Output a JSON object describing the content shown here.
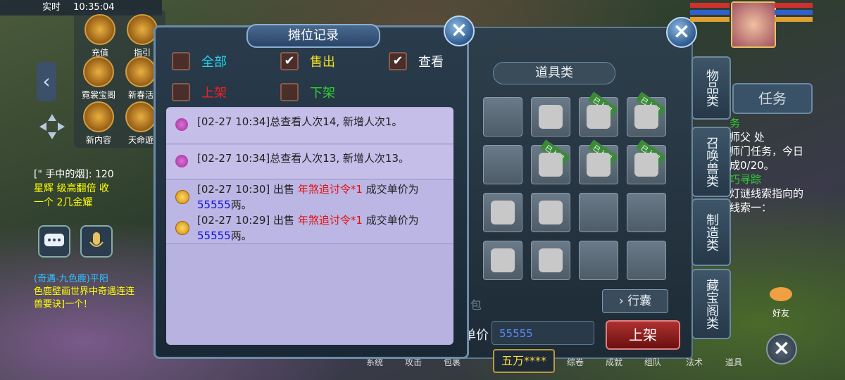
{
  "status": {
    "time_label": "实时",
    "time": "10:35:04"
  },
  "left_menu": [
    {
      "label": "充值",
      "icon": "treasure-chest-icon"
    },
    {
      "label": "指引",
      "icon": "guide-icon"
    },
    {
      "label": "霓裳宝阁",
      "icon": "costume-shop-icon"
    },
    {
      "label": "新春活",
      "icon": "spring-event-icon"
    },
    {
      "label": "新内容",
      "icon": "new-content-icon"
    },
    {
      "label": "天命遊",
      "icon": "fate-icon"
    }
  ],
  "chat": {
    "line1": "[\" 手中的烟]: 120",
    "line2": "星辉 级高翻倍 收",
    "line3": "一个 2几金耀",
    "world1": "(奇遇-九色鹿)平阳",
    "world2": "色鹿壁画世界中奇遇连连",
    "world3": "兽要诀]一个！"
  },
  "dialog": {
    "title": "摊位记录",
    "filters": [
      {
        "label": "全部",
        "checked": false,
        "color": "#22d8f0"
      },
      {
        "label": "售出",
        "checked": true,
        "color": "#f0e020"
      },
      {
        "label": "查看",
        "checked": true,
        "color": "#ffffff"
      },
      {
        "label": "上架",
        "checked": false,
        "color": "#f02020"
      },
      {
        "label": "下架",
        "checked": false,
        "color": "#30d030"
      }
    ],
    "records": [
      {
        "icon": "person-icon",
        "text": "[02-27 10:34]总查看人次14, 新增人次1。"
      },
      {
        "icon": "person-icon",
        "text": "[02-27 10:34]总查看人次13, 新增人次13。"
      },
      {
        "icon": "coin-icon",
        "prefix": "[02-27 10:30] 出售 ",
        "item": "年煞追讨令",
        "qty": "*1",
        "mid": " 成交单价为",
        "price": "55555",
        "suffix": "两。"
      },
      {
        "icon": "coin-icon",
        "prefix": "[02-27 10:29] 出售 ",
        "item": "年煞追讨令",
        "qty": "*1",
        "mid": " 成交单价为",
        "price": "55555",
        "suffix": "两。"
      }
    ]
  },
  "bag": {
    "category": "道具类",
    "tag": "已上架",
    "bag_button": "行囊",
    "price_label": "单价",
    "price_value": "55555",
    "sell_button": "上架",
    "money": "五万****",
    "bag_hint": "包"
  },
  "right_tabs": [
    "物品类",
    "召唤兽类",
    "制造类",
    "藏宝阁类"
  ],
  "task_tab": "任务",
  "quest": {
    "title": "务",
    "l1": "师父",
    "l1b": "处",
    "l2": "师门任务，今日",
    "l3": "成0/20。",
    "l4": "巧寻踪",
    "l5": "灯谜线索指向的",
    "l6": "线索一："
  },
  "bottom_labels": [
    "系统",
    "攻击",
    "包裹",
    "综卷",
    "成就",
    "组队",
    "法术",
    "道具"
  ],
  "friend_label": "好友",
  "colors": {
    "price_blue": "#1010e0",
    "item_red": "#e01010",
    "sell_red": "#b03030"
  }
}
